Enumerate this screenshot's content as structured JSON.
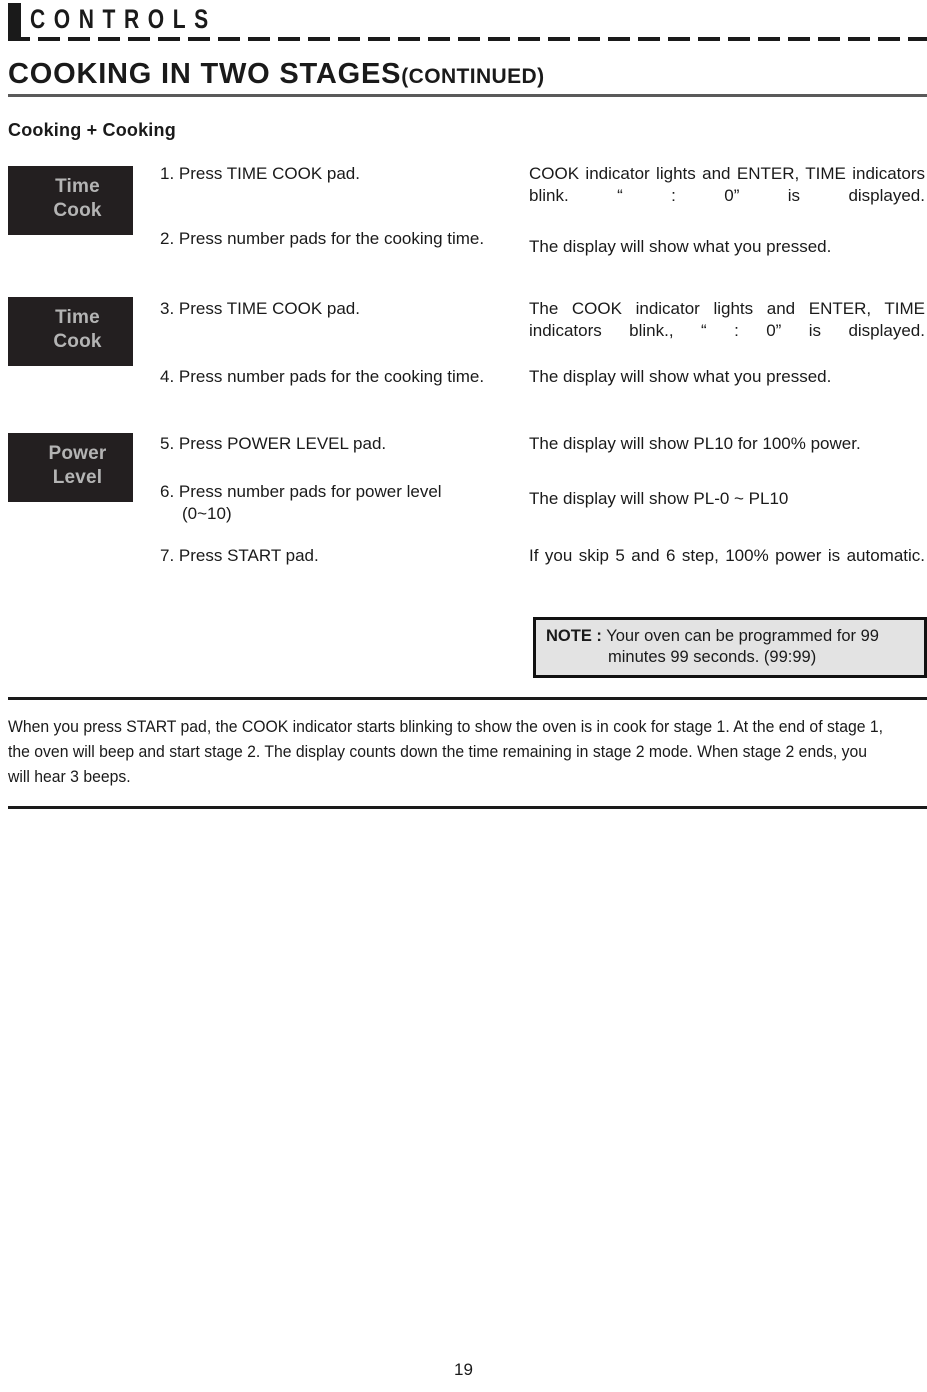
{
  "header": {
    "label": "CONTROLS"
  },
  "section": {
    "title": "COOKING IN TWO STAGES",
    "continued": "(CONTINUED)",
    "subtitle": "Cooking + Cooking"
  },
  "pads": [
    {
      "line1": "Time",
      "line2": "Cook"
    },
    {
      "line1": "Time",
      "line2": "Cook"
    },
    {
      "line1": "Power",
      "line2": "Level"
    }
  ],
  "steps": [
    {
      "instruction": "1. Press TIME COOK pad.",
      "result": "COOK indicator lights and ENTER, TIME indicators blink. “ : 0” is displayed."
    },
    {
      "instruction": "2. Press number pads for the cooking time.",
      "result": "The display will show what you pressed."
    },
    {
      "instruction": "3. Press TIME COOK pad.",
      "result": "The COOK indicator lights and ENTER, TIME indicators blink., “ : 0” is displayed."
    },
    {
      "instruction": "4. Press number pads for the cooking time.",
      "result": "The display will show what you pressed."
    },
    {
      "instruction": "5. Press POWER LEVEL pad.",
      "result": "The display will show PL10 for 100% power."
    },
    {
      "instruction": "6. Press number pads for power level (0~10)",
      "result": "The display will show PL-0 ~ PL10"
    },
    {
      "instruction": "7. Press START pad.",
      "result": "If you skip 5 and 6 step, 100% power is automatic."
    }
  ],
  "note": {
    "label": "NOTE :",
    "text": " Your oven can be programmed for 99 minutes 99 seconds. (99:99)"
  },
  "bottom_paragraph": "When you press START pad, the COOK indicator starts blinking to show the oven is in cook for stage 1. At the end of stage 1, the oven will beep and start stage 2. The display counts down the time remaining in stage 2 mode. When stage 2 ends, you will hear 3 beeps.",
  "page_number": "19",
  "colors": {
    "ink": "#1a1a1a",
    "pad_background": "#231f20",
    "pad_text": "#b4b4b4",
    "note_background": "#e3e3e3",
    "rule_gray": "#5a5a5a"
  }
}
